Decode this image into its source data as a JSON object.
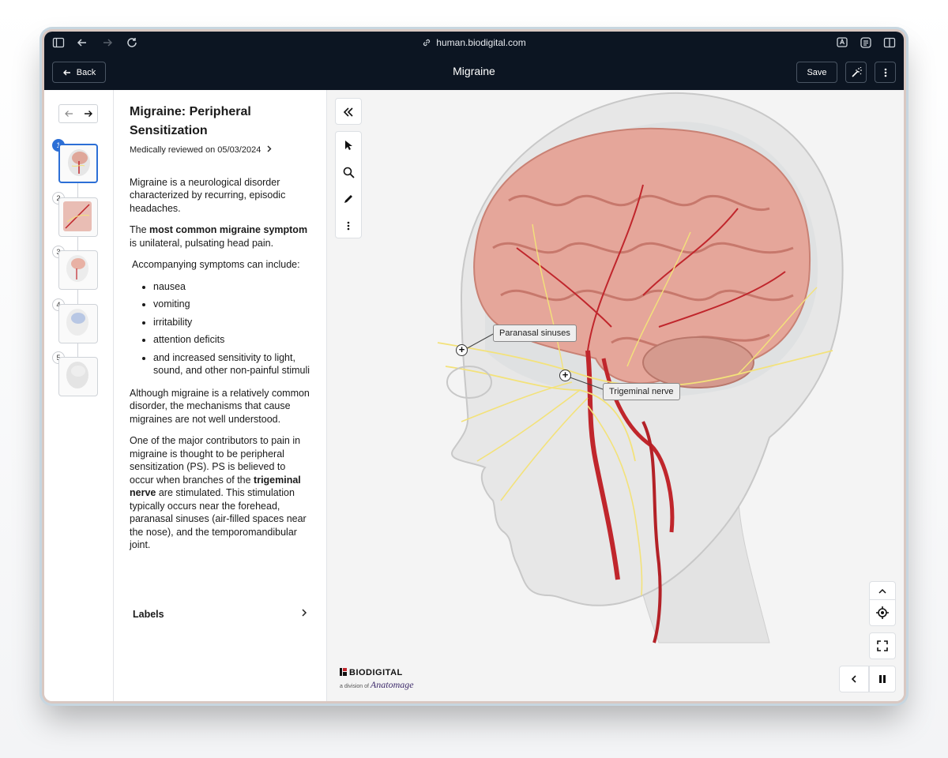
{
  "browser": {
    "url": "human.biodigital.com"
  },
  "header": {
    "back_label": "Back",
    "title": "Migraine",
    "save_label": "Save"
  },
  "steps": [
    {
      "number": "1",
      "active": true
    },
    {
      "number": "2",
      "active": false
    },
    {
      "number": "3",
      "active": false
    },
    {
      "number": "4",
      "active": false
    },
    {
      "number": "5",
      "active": false
    }
  ],
  "article": {
    "title": "Migraine: Peripheral Sensitization",
    "reviewed": "Medically reviewed on 05/03/2024",
    "p1": "Migraine is a neurological disorder characterized by recurring, episodic headaches.",
    "p2_pre": "The ",
    "p2_bold": "most common migraine symptom",
    "p2_post": " is unilateral, pulsating head pain.",
    "p3": "Accompanying symptoms can include:",
    "symptoms": [
      "nausea",
      "vomiting",
      "irritability",
      "attention deficits",
      "and increased sensitivity to light, sound, and other non-painful stimuli"
    ],
    "p4": "Although migraine is a relatively common disorder, the mechanisms that cause migraines are not well understood.",
    "p5_pre": "One of the major contributors to pain in migraine is thought to be peripheral sensitization (PS). PS is believed to occur when branches of the ",
    "p5_bold": "trigeminal nerve",
    "p5_post": " are stimulated. This stimulation typically occurs near the forehead, paranasal sinuses (air-filled spaces near the nose), and the temporomandibular joint.",
    "labels_section": "Labels"
  },
  "viewer": {
    "labels": [
      "Paranasal sinuses",
      "Trigeminal nerve"
    ],
    "brand_name": "BIODIGITAL",
    "brand_sub": "a division of",
    "brand_parent": "Anatomage"
  },
  "colors": {
    "chrome_bg": "#0c1522",
    "accent": "#2c6fd6",
    "nerve": "#f3e27a",
    "artery": "#c0262c"
  }
}
